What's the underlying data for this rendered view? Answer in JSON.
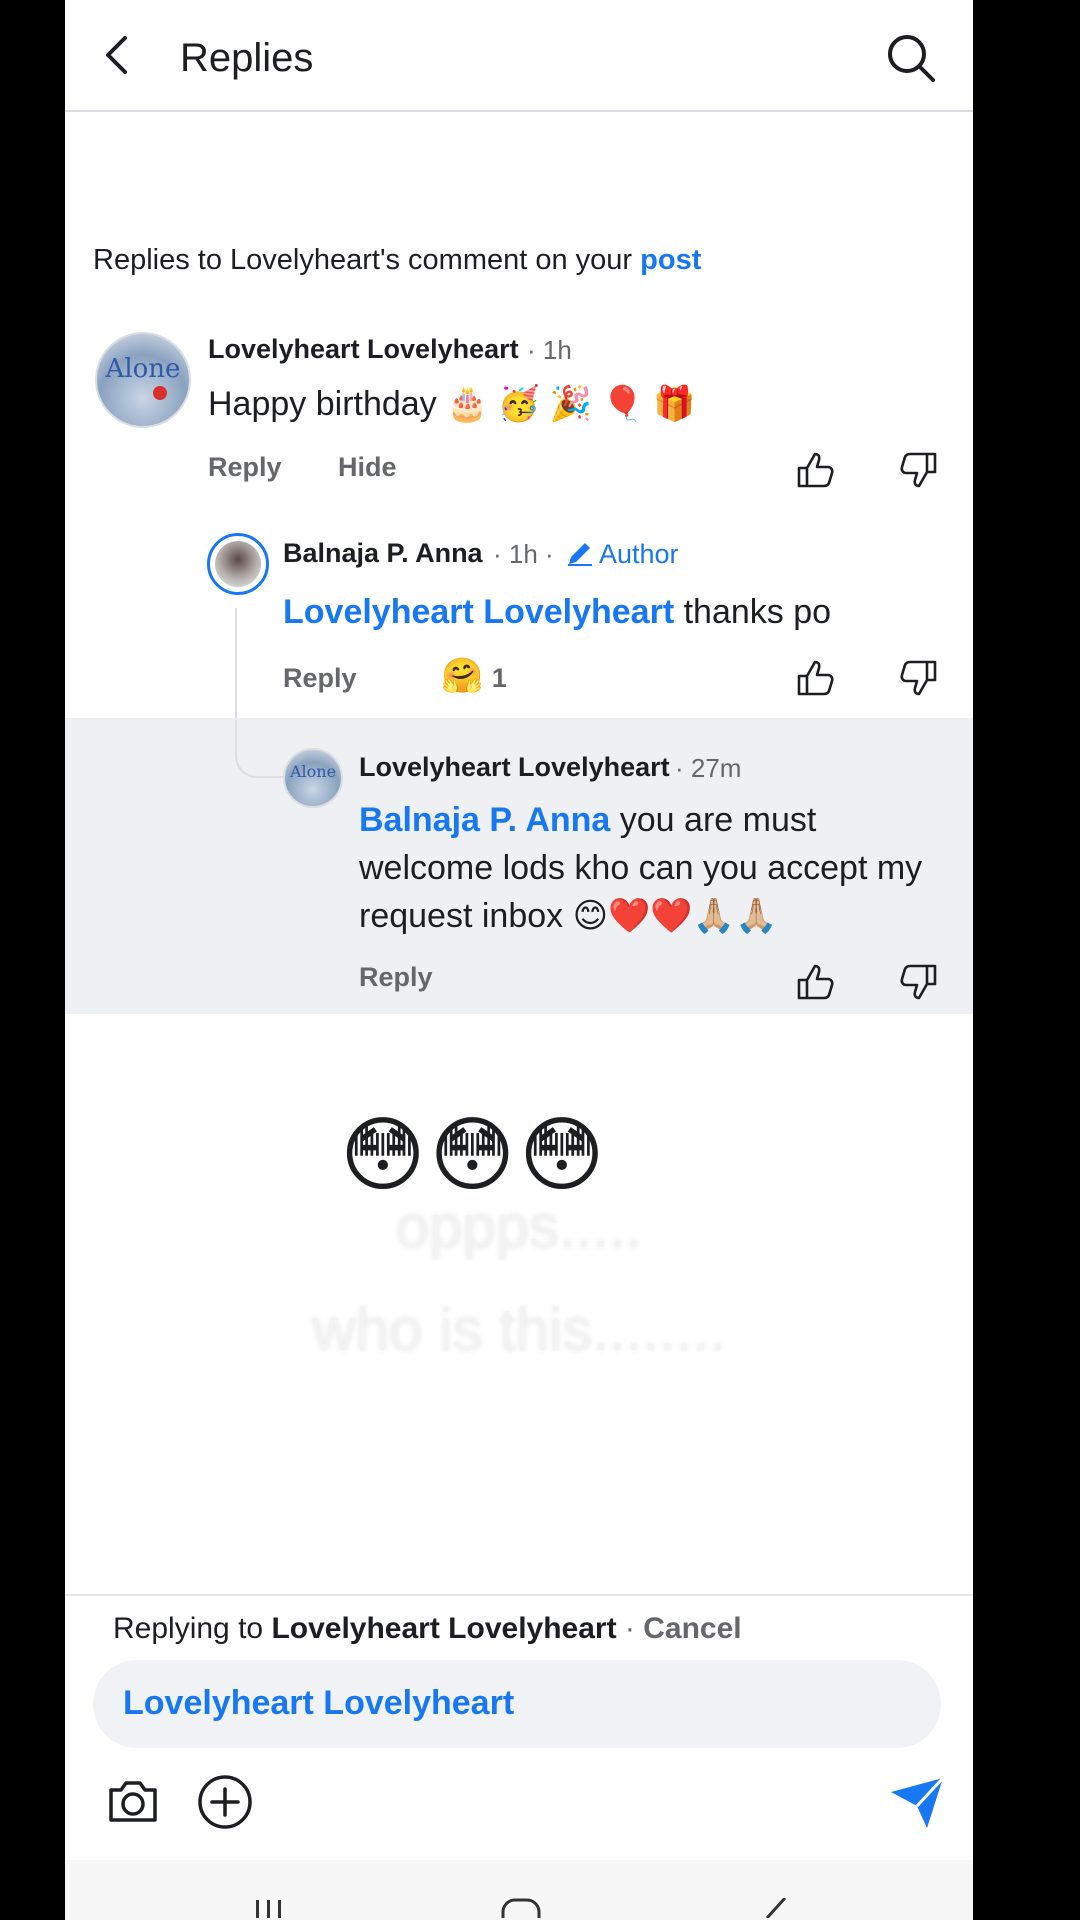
{
  "topbar": {
    "title": "Replies"
  },
  "context": {
    "prefix": "Replies to Lovelyheart's comment on your ",
    "link": "post"
  },
  "comments": [
    {
      "avatar_text": "Alone",
      "name": "Lovelyheart Lovelyheart",
      "time": "· 1h",
      "text": "Happy birthday 🎂 🥳 🎉 🎈 🎁",
      "actions": {
        "reply": "Reply",
        "hide": "Hide"
      }
    },
    {
      "name": "Balnaja P. Anna",
      "time": "· 1h ·",
      "author_badge": "Author",
      "mention": "Lovelyheart Lovelyheart",
      "text": " thanks po",
      "actions": {
        "reply": "Reply"
      },
      "reaction": {
        "emoji": "🤗",
        "count": "1"
      }
    },
    {
      "avatar_text": "Alone",
      "name": "Lovelyheart Lovelyheart",
      "time": "· 27m",
      "mention": "Balnaja P. Anna",
      "text": " you are must welcome lods kho can you accept my request inbox 😊❤️❤️🙏🏼🙏🏼",
      "actions": {
        "reply": "Reply"
      }
    }
  ],
  "overlay": {
    "emojis": "😳😳😳",
    "line1": "oppps.....",
    "line2": "who is this........"
  },
  "composer": {
    "replying_prefix": "Replying to ",
    "replying_name": "Lovelyheart Lovelyheart",
    "separator": " · ",
    "cancel": "Cancel",
    "input_value": "Lovelyheart Lovelyheart"
  },
  "colors": {
    "accent": "#1877f2",
    "secondary_text": "#65676b",
    "highlight_bg": "#eef0f3"
  }
}
